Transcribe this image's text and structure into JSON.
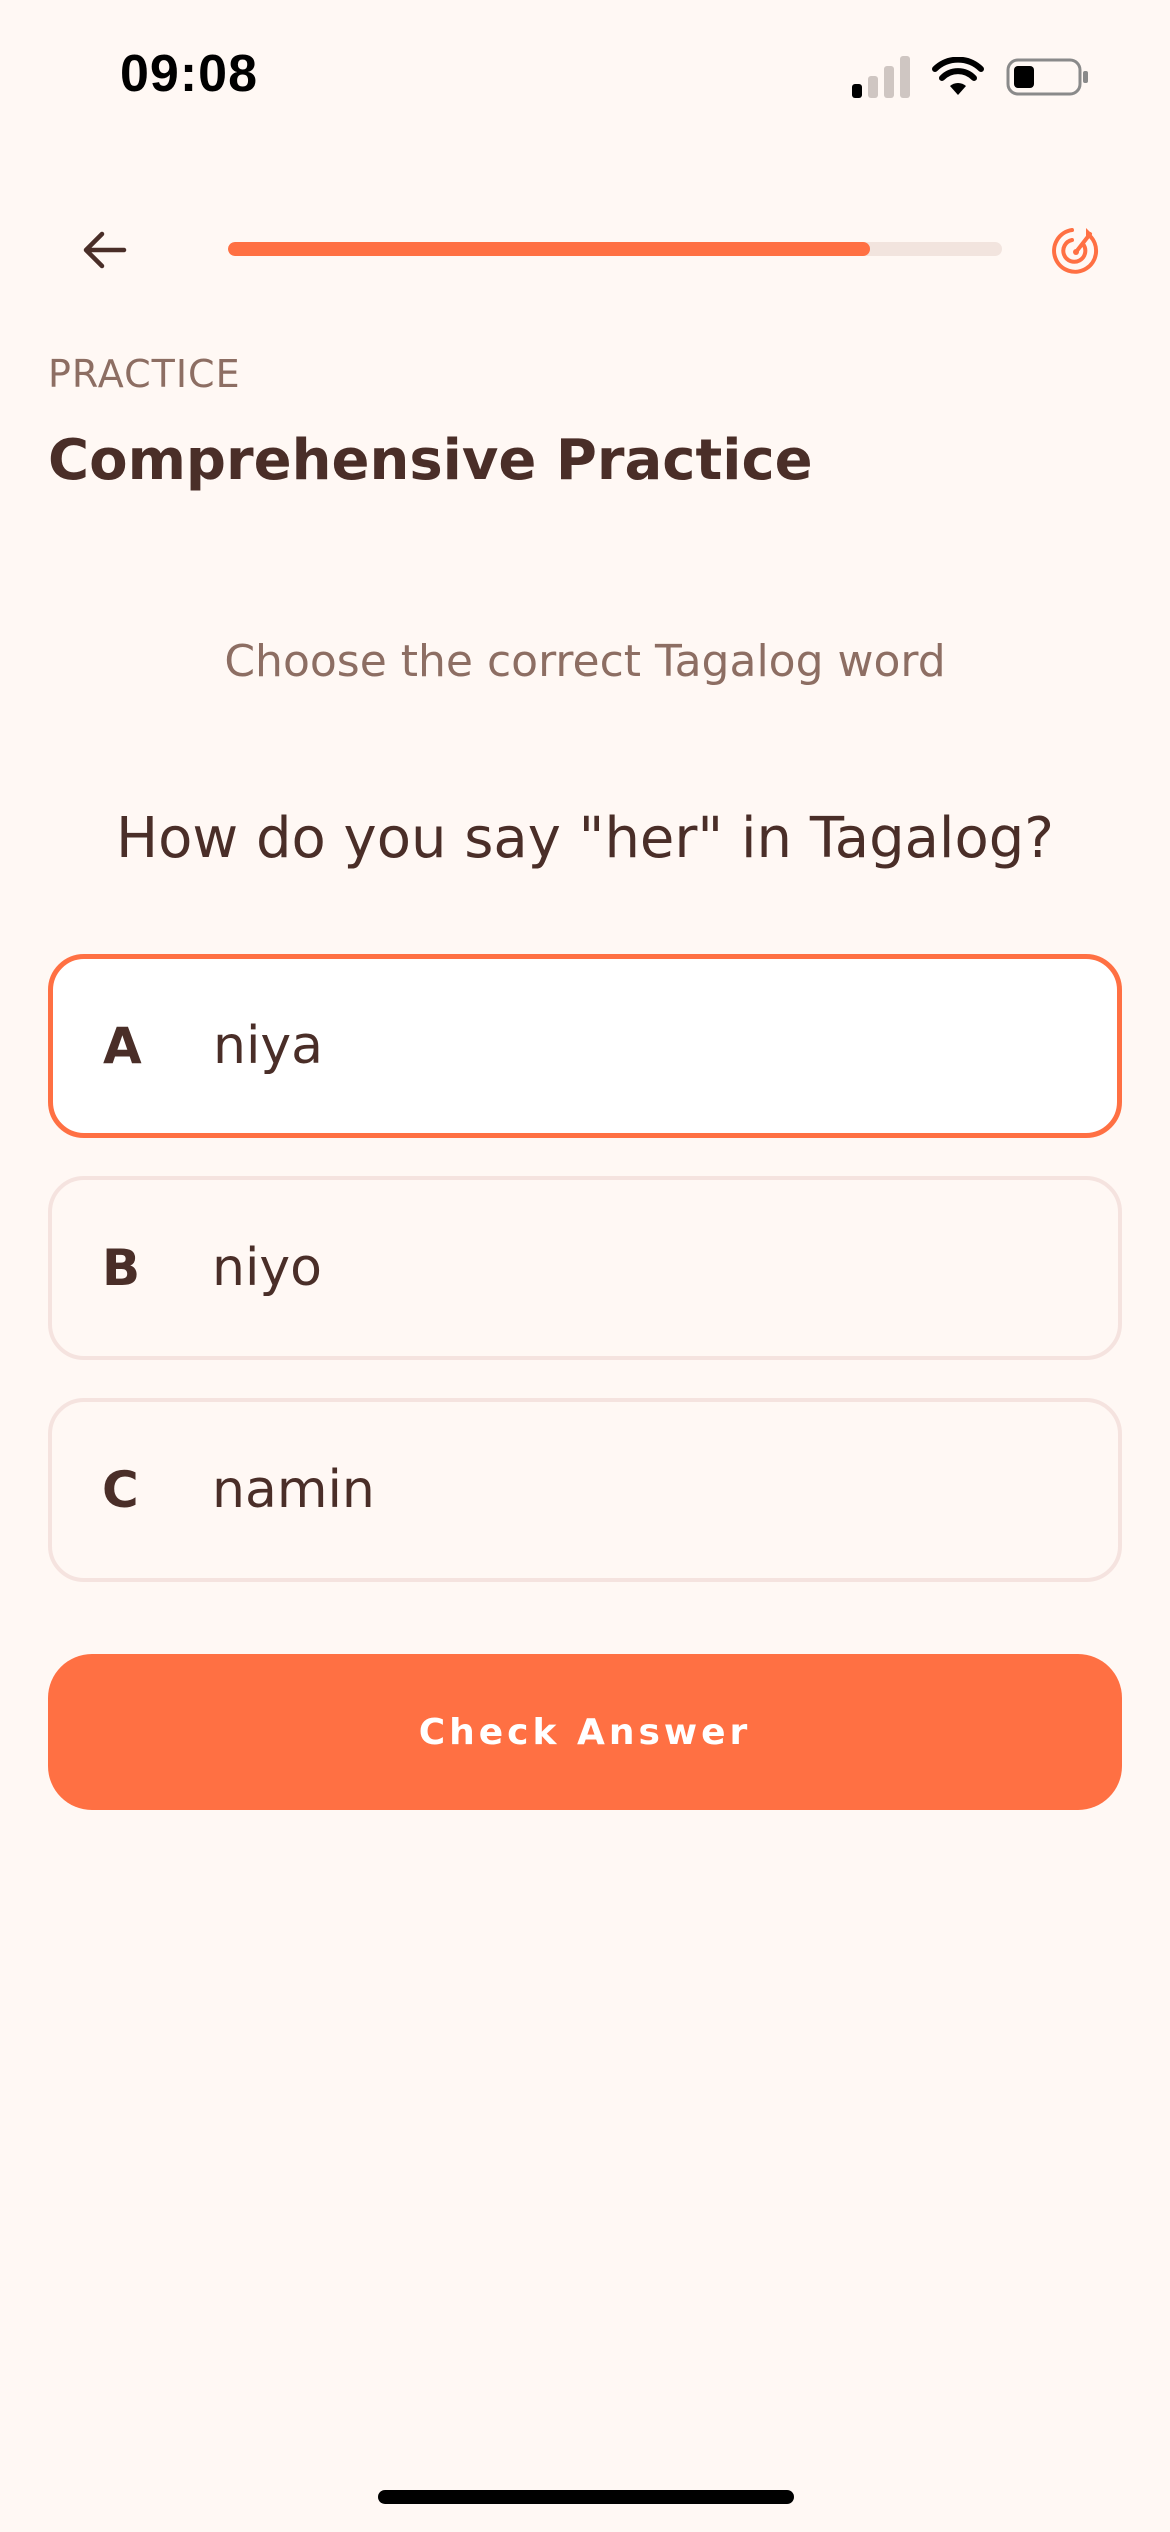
{
  "status_bar": {
    "time": "09:08",
    "icons": [
      "cellular-signal-icon",
      "wifi-icon",
      "battery-icon"
    ]
  },
  "nav": {
    "back_icon": "arrow-left-icon",
    "progress_fraction": 0.83,
    "goal_icon": "target-icon"
  },
  "header": {
    "section_label": "PRACTICE",
    "title": "Comprehensive Practice"
  },
  "quiz": {
    "instruction": "Choose the correct Tagalog word",
    "question": "How do you say \"her\" in Tagalog?",
    "options": [
      {
        "letter": "A",
        "text": "niya",
        "selected": true
      },
      {
        "letter": "B",
        "text": "niyo",
        "selected": false
      },
      {
        "letter": "C",
        "text": "namin",
        "selected": false
      }
    ],
    "check_label": "Check Answer"
  },
  "colors": {
    "accent": "#FF7043",
    "background": "#FFF8F4",
    "text_primary": "#4A2E28",
    "text_secondary": "#8D6E63",
    "option_border": "#F5E3DF"
  }
}
